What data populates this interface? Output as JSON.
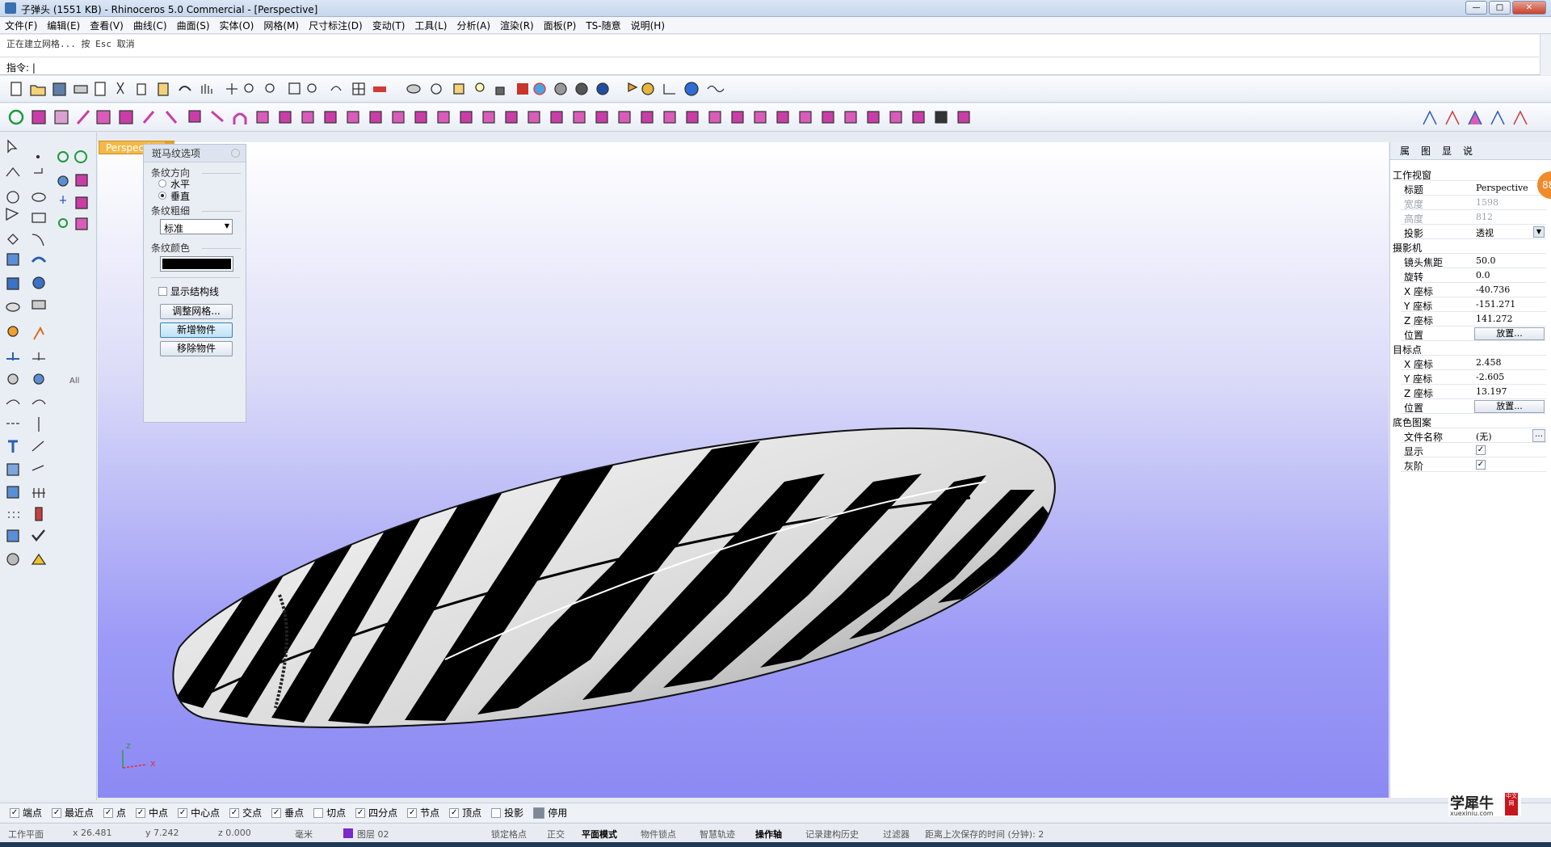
{
  "window": {
    "title": "子弹头 (1551 KB) - Rhinoceros 5.0 Commercial - [Perspective]",
    "min": "—",
    "max": "□",
    "close": "✕"
  },
  "menu": [
    "文件(F)",
    "编辑(E)",
    "查看(V)",
    "曲线(C)",
    "曲面(S)",
    "实体(O)",
    "网格(M)",
    "尺寸标注(D)",
    "变动(T)",
    "工具(L)",
    "分析(A)",
    "渲染(R)",
    "面板(P)",
    "TS-随意",
    "说明(H)"
  ],
  "command": {
    "history": "正在建立网格... 按 Esc 取消",
    "prompt": "指令: |"
  },
  "viewport": {
    "tab_label": "Perspective",
    "axis_x": "x",
    "axis_z": "z"
  },
  "zebra": {
    "title": "斑马纹选项",
    "direction_label": "条纹方向",
    "horizontal": "水平",
    "vertical": "垂直",
    "thickness_label": "条纹粗细",
    "thickness_value": "标准",
    "color_label": "条纹颜色",
    "color": "#000000",
    "show_struct": "显示结构线",
    "adjust_mesh": "调整网格...",
    "add_object": "新增物件",
    "remove_object": "移除物件"
  },
  "left_toolbar": {
    "all_label": "All"
  },
  "panel": {
    "tabs": [
      "属",
      "图",
      "显",
      "说"
    ],
    "sections": {
      "workview": "工作视窗",
      "camera": "摄影机",
      "target": "目标点",
      "background": "底色图案"
    },
    "rows": {
      "title_k": "标题",
      "title_v": "Perspective",
      "width_k": "宽度",
      "width_v": "1598",
      "height_k": "高度",
      "height_v": "812",
      "proj_k": "投影",
      "proj_v": "透视",
      "lens_k": "镜头焦距",
      "lens_v": "50.0",
      "rot_k": "旋转",
      "rot_v": "0.0",
      "cx_k": "X 座标",
      "cx_v": "-40.736",
      "cy_k": "Y 座标",
      "cy_v": "-151.271",
      "cz_k": "Z 座标",
      "cz_v": "141.272",
      "pos_k": "位置",
      "pos_btn": "放置...",
      "tx_k": "X 座标",
      "tx_v": "2.458",
      "ty_k": "Y 座标",
      "ty_v": "-2.605",
      "tz_k": "Z 座标",
      "tz_v": "13.197",
      "tpos_k": "位置",
      "tpos_btn": "放置...",
      "file_k": "文件名称",
      "file_v": "(无)",
      "show_k": "显示",
      "gray_k": "灰阶"
    },
    "badge": "88"
  },
  "osnaps": [
    {
      "label": "端点",
      "checked": true
    },
    {
      "label": "最近点",
      "checked": true
    },
    {
      "label": "点",
      "checked": true
    },
    {
      "label": "中点",
      "checked": true
    },
    {
      "label": "中心点",
      "checked": true
    },
    {
      "label": "交点",
      "checked": true
    },
    {
      "label": "垂点",
      "checked": true
    },
    {
      "label": "切点",
      "checked": false
    },
    {
      "label": "四分点",
      "checked": true
    },
    {
      "label": "节点",
      "checked": true
    },
    {
      "label": "顶点",
      "checked": true
    },
    {
      "label": "投影",
      "checked": false
    },
    {
      "label": "停用",
      "checked": false
    }
  ],
  "status": {
    "cplane": "工作平面",
    "x": "x 26.481",
    "y": "y 7.242",
    "z": "z 0.000",
    "unit": "毫米",
    "layer": "图层 02",
    "grid_snap": "锁定格点",
    "ortho": "正交",
    "planar": "平面模式",
    "osnap": "物件锁点",
    "smarttrack": "智慧轨迹",
    "gumball": "操作轴",
    "history": "记录建构历史",
    "filter": "过滤器",
    "autosave": "距离上次保存的时间 (分钟): 2"
  },
  "watermark": {
    "title": "学犀牛",
    "site": "xuexiniu.com",
    "tag": "中文网"
  }
}
